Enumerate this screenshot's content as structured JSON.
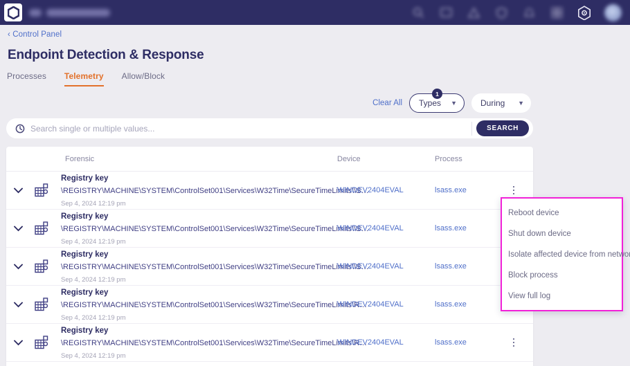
{
  "topnav": {
    "logo_name": "hexagon-logo",
    "icons": [
      "search-icon",
      "dashboard-icon",
      "alert-triangle-icon",
      "shield-icon",
      "bell-icon",
      "grid-icon",
      "settings-gear-icon"
    ],
    "avatar_label": "user-avatar"
  },
  "breadcrumb": {
    "label": "‹ Control Panel"
  },
  "header": {
    "title": "Endpoint Detection & Response"
  },
  "tabs": [
    {
      "label": "Processes",
      "active": false
    },
    {
      "label": "Telemetry",
      "active": true
    },
    {
      "label": "Allow/Block",
      "active": false
    }
  ],
  "filters": {
    "clear_all_label": "Clear All",
    "types": {
      "label": "Types",
      "badge": "1"
    },
    "during": {
      "label": "During"
    }
  },
  "search": {
    "placeholder": "Search single or multiple values...",
    "value": "",
    "button_label": "SEARCH",
    "icon": "history-clock-icon"
  },
  "table": {
    "columns": [
      "Forensic",
      "Device",
      "Process"
    ],
    "rows": [
      {
        "type": "Registry key",
        "path": "\\REGISTRY\\MACHINE\\SYSTEM\\ControlSet001\\Services\\W32Time\\SecureTimeLimits\\\\S…",
        "time": "Sep 4, 2024 12:19 pm",
        "device": "WINDEV2404EVAL",
        "process": "lsass.exe"
      },
      {
        "type": "Registry key",
        "path": "\\REGISTRY\\MACHINE\\SYSTEM\\ControlSet001\\Services\\W32Time\\SecureTimeLimits\\\\S…",
        "time": "Sep 4, 2024 12:19 pm",
        "device": "WINDEV2404EVAL",
        "process": "lsass.exe"
      },
      {
        "type": "Registry key",
        "path": "\\REGISTRY\\MACHINE\\SYSTEM\\ControlSet001\\Services\\W32Time\\SecureTimeLimits\\\\S…",
        "time": "Sep 4, 2024 12:19 pm",
        "device": "WINDEV2404EVAL",
        "process": "lsass.exe"
      },
      {
        "type": "Registry key",
        "path": "\\REGISTRY\\MACHINE\\SYSTEM\\ControlSet001\\Services\\W32Time\\SecureTimeLimits\\R…",
        "time": "Sep 4, 2024 12:19 pm",
        "device": "WINDEV2404EVAL",
        "process": "lsass.exe"
      },
      {
        "type": "Registry key",
        "path": "\\REGISTRY\\MACHINE\\SYSTEM\\ControlSet001\\Services\\W32Time\\SecureTimeLimits\\R…",
        "time": "Sep 4, 2024 12:19 pm",
        "device": "WINDEV2404EVAL",
        "process": "lsass.exe"
      }
    ]
  },
  "context_menu": {
    "items": [
      "Reboot device",
      "Shut down device",
      "Isolate affected device from network",
      "Block process",
      "View full log"
    ],
    "highlight_color": "#f221d8"
  },
  "colors": {
    "navy": "#2e2d64",
    "accent_orange": "#e2712b",
    "link_blue": "#4f6fc9",
    "page_bg": "#edecf1"
  }
}
